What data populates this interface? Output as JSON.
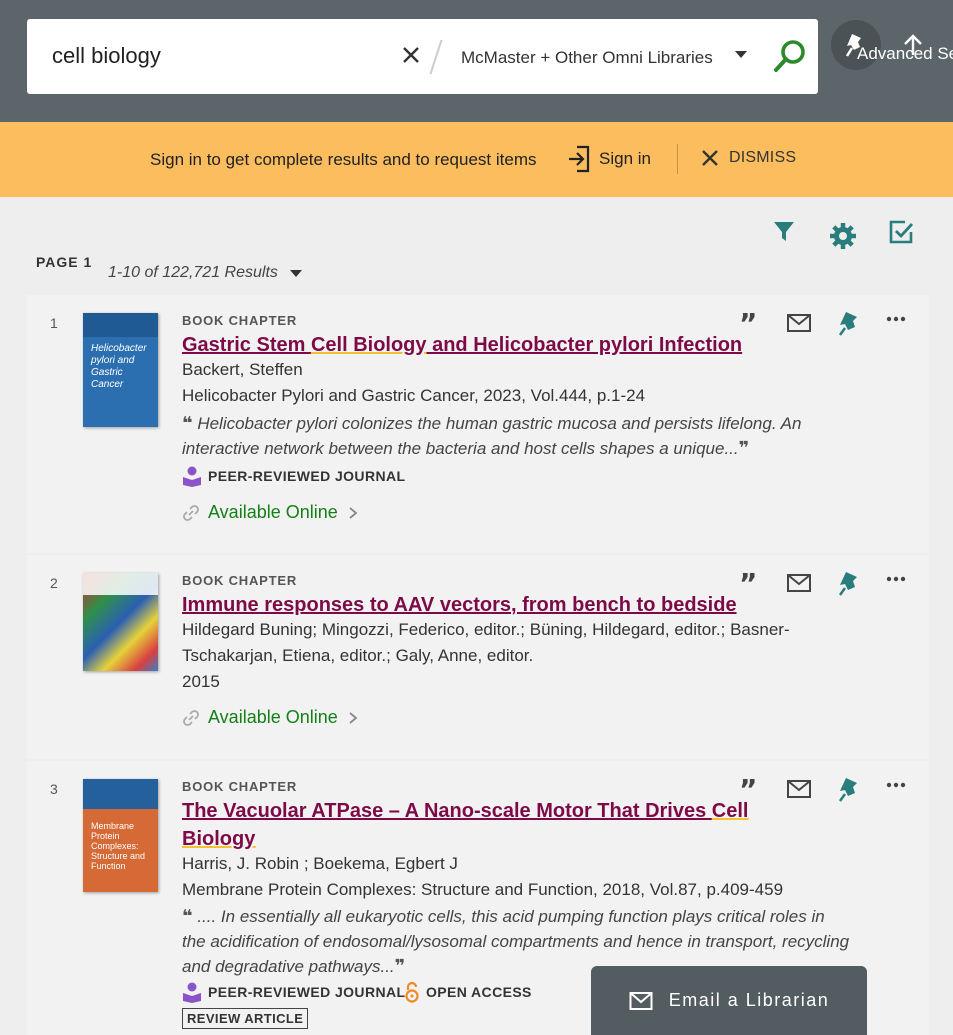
{
  "search": {
    "query": "cell biology",
    "scope": "McMaster + Other Omni Libraries",
    "advanced_label": "Advanced Se"
  },
  "banner": {
    "message": "Sign in to get complete results and to request items",
    "signin_label": "Sign in",
    "dismiss_label": "DISMISS"
  },
  "results_header": {
    "page_label": "PAGE 1",
    "count_label": "1-10 of 122,721 Results"
  },
  "results": [
    {
      "number": "1",
      "type": "BOOK CHAPTER",
      "title_parts": [
        "Gastric Stem ",
        "Cell Biology",
        " and Helicobacter pylori Infection"
      ],
      "authors": "Backert, Steffen",
      "source": "Helicobacter Pylori and Gastric Cancer, 2023, Vol.444, p.1-24",
      "snippet": "Helicobacter pylori colonizes the human gastric mucosa and persists lifelong. An interactive network between the bacteria and host cells shapes a unique...",
      "badge": "PEER-REVIEWED JOURNAL",
      "availability": "Available Online",
      "thumb_title": "Helicobacter pylori and Gastric Cancer"
    },
    {
      "number": "2",
      "type": "BOOK CHAPTER",
      "title": "Immune responses to AAV vectors, from bench to bedside",
      "authors_line1": "Hildegard Buning; Mingozzi, Federico, editor.; Büning, Hildegard, editor.; Basner-",
      "authors_line2": "Tschakarjan, Etiena, editor.; Galy, Anne, editor.",
      "year": "2015",
      "availability": "Available Online"
    },
    {
      "number": "3",
      "type": "BOOK CHAPTER",
      "title_line1_parts": [
        "The Vacuolar ATPase – A Nano-scale Motor That Drives ",
        "Cell"
      ],
      "title_line2": "Biology",
      "authors": "Harris, J. Robin ; Boekema, Egbert J",
      "source": "Membrane Protein Complexes: Structure and Function, 2018, Vol.87, p.409-459",
      "snippet": ".... In essentially all eukaryotic cells, this acid pumping function plays critical roles in the acidification of endosomal/lysosomal compartments and hence in transport, recycling and degradative pathways...",
      "badge_peer": "PEER-REVIEWED JOURNAL",
      "badge_open": "OPEN ACCESS",
      "review_tag": "REVIEW ARTICLE",
      "thumb_title": "Membrane Protein Complexes: Structure and Function"
    }
  ],
  "email_fab": {
    "label": "Email a Librarian"
  },
  "colors": {
    "topbar": "#5c6569",
    "banner": "#fbbd5e",
    "title_link": "#7d0a47",
    "available": "#148018",
    "teal_icon": "#2a7d7d",
    "search_green": "#2b8a2b"
  }
}
